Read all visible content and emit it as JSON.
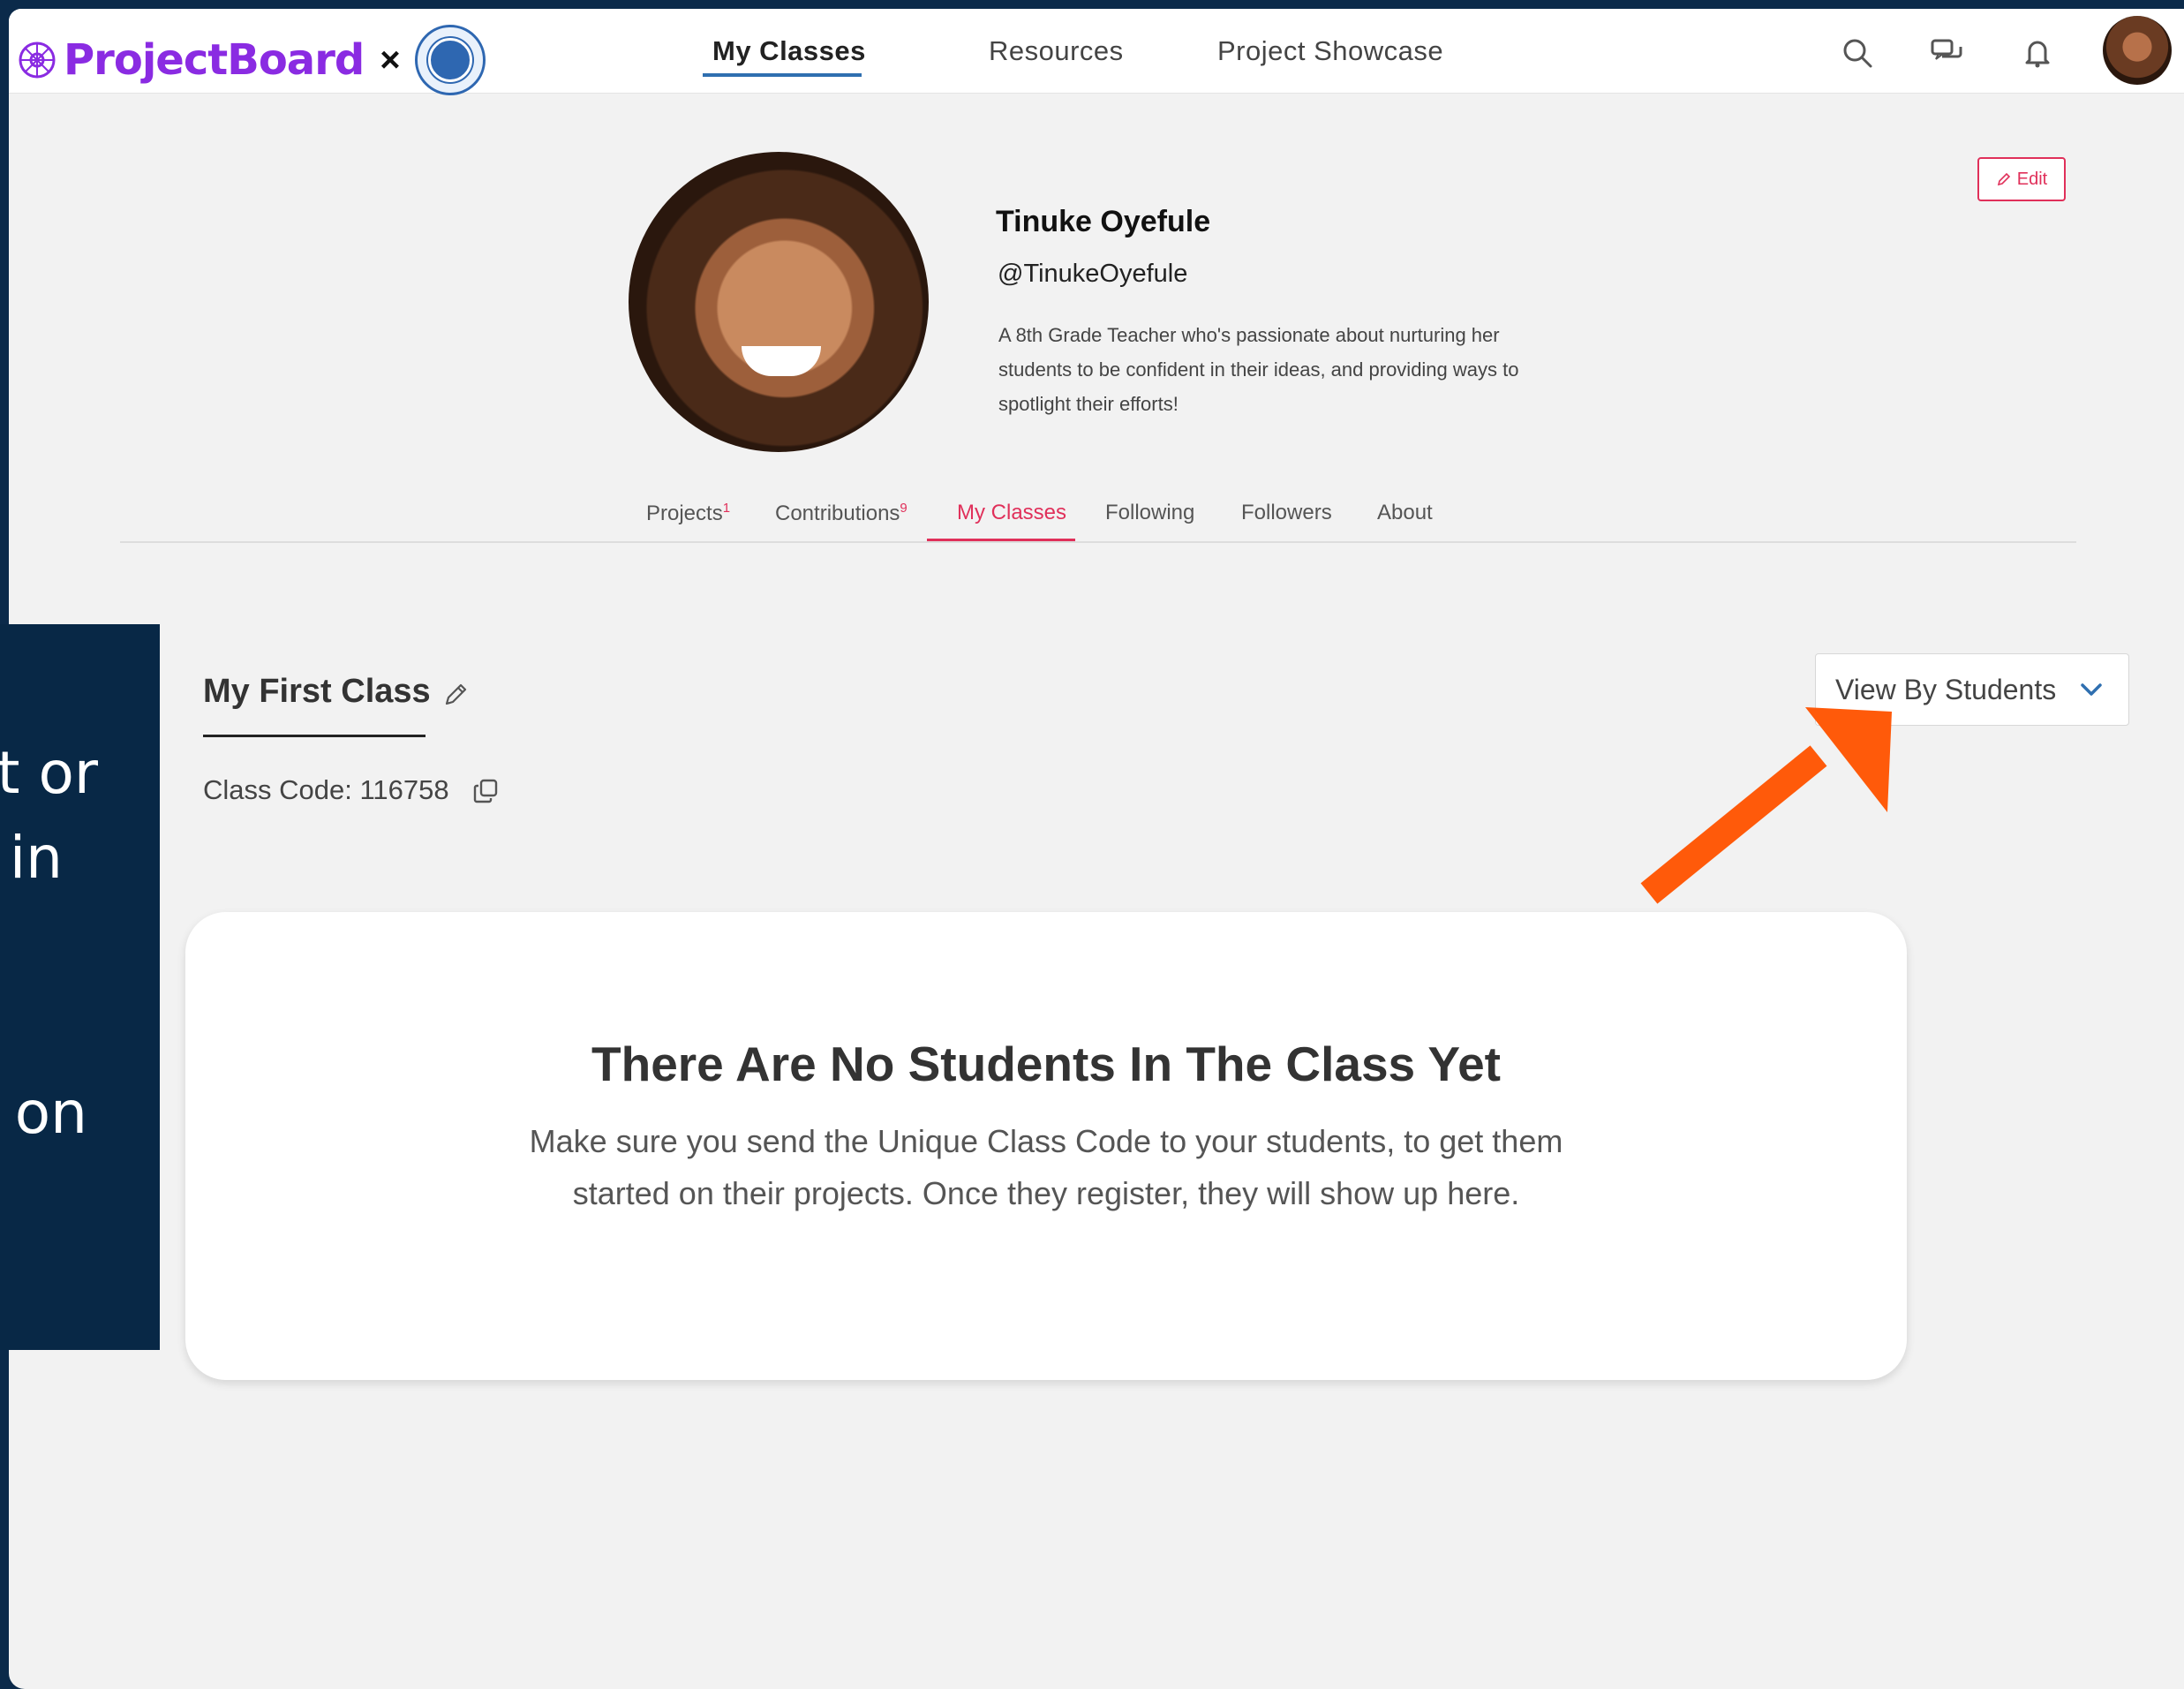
{
  "header": {
    "brand": "ProjectBoard",
    "separator": "×",
    "nav": [
      "My Classes",
      "Resources",
      "Project Showcase"
    ],
    "icons": [
      "search-icon",
      "messages-icon",
      "bell-icon"
    ]
  },
  "profile": {
    "name": "Tinuke Oyefule",
    "handle": "@TinukeOyefule",
    "bio": "A 8th Grade Teacher who's passionate about nurturing her students to be confident in their ideas, and providing ways to spotlight their efforts!",
    "edit_label": "Edit",
    "tabs": [
      {
        "label": "Projects",
        "count": "1"
      },
      {
        "label": "Contributions",
        "count": "9"
      },
      {
        "label": "My Classes",
        "count": ""
      },
      {
        "label": "Following",
        "count": ""
      },
      {
        "label": "Followers",
        "count": ""
      },
      {
        "label": "About",
        "count": ""
      }
    ]
  },
  "class": {
    "name": "My First Class",
    "code_label": "Class Code: 116758",
    "view_select": "View By Students"
  },
  "empty_state": {
    "title": "There Are No Students In The Class Yet",
    "message": "Make sure you send the Unique Class Code to your students, to get them started on their projects. Once they register, they will show up here."
  },
  "side_panel": {
    "lines": [
      "t or",
      "in",
      "on"
    ]
  },
  "colors": {
    "brand": "#8a2be2",
    "accent": "#e0305a",
    "nav_underline": "#2f6fb0",
    "arrow": "#ff5a0a",
    "panel": "#082846"
  }
}
